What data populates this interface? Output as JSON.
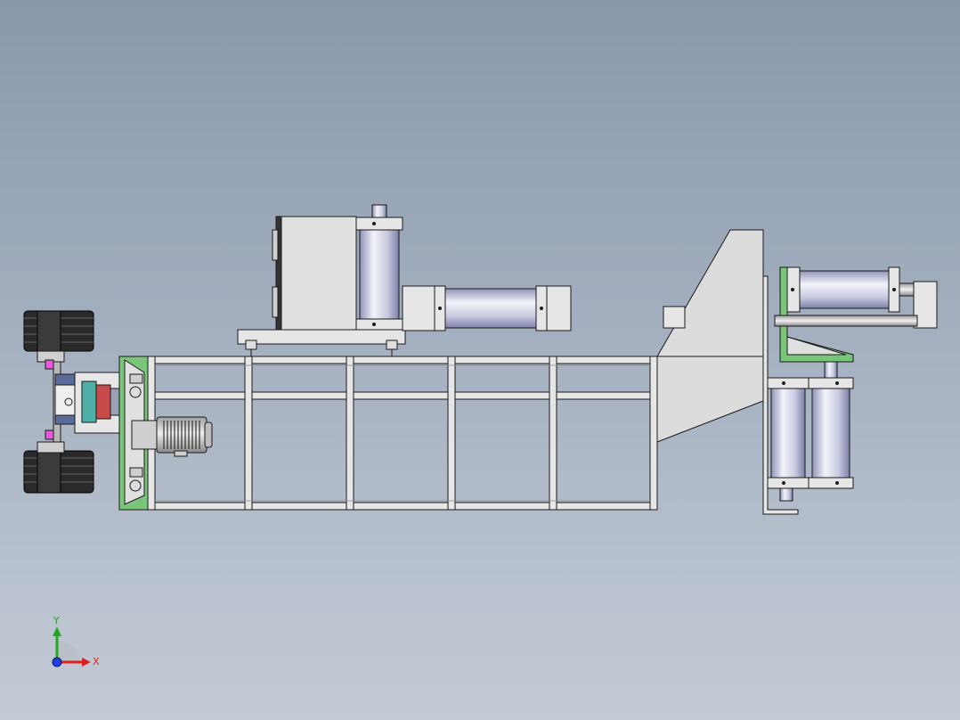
{
  "viewport": {
    "background_top": "#8a98ab",
    "background_bottom": "#c4cbd6"
  },
  "colors": {
    "sheet_metal": "#d9d9d9",
    "frame_tube": "#e6e6e6",
    "edge": "#1a1a1a",
    "bracket_green": "#79c57a",
    "cylinder_light": "#eceef6",
    "cylinder_dark": "#8f93b8",
    "tire": "#2a2a2a",
    "motor_body": "#c8c8c8",
    "motor_fins": "#333333",
    "accent_magenta": "#e45ad8",
    "accent_red": "#c94a4a",
    "accent_teal": "#4fb0a8",
    "axis_x": "#e02020",
    "axis_y": "#22aa22",
    "axis_z": "#2040e0"
  },
  "triad": {
    "x_label": "X",
    "y_label": "Y",
    "icon": "coordinate-triad-icon"
  },
  "assembly_parts": [
    "left-wheel-assembly-icon",
    "gear-motor-icon",
    "main-frame-icon",
    "press-box-icon",
    "horizontal-cylinder-icon",
    "discharge-hopper-icon",
    "right-cylinder-cluster-icon"
  ]
}
